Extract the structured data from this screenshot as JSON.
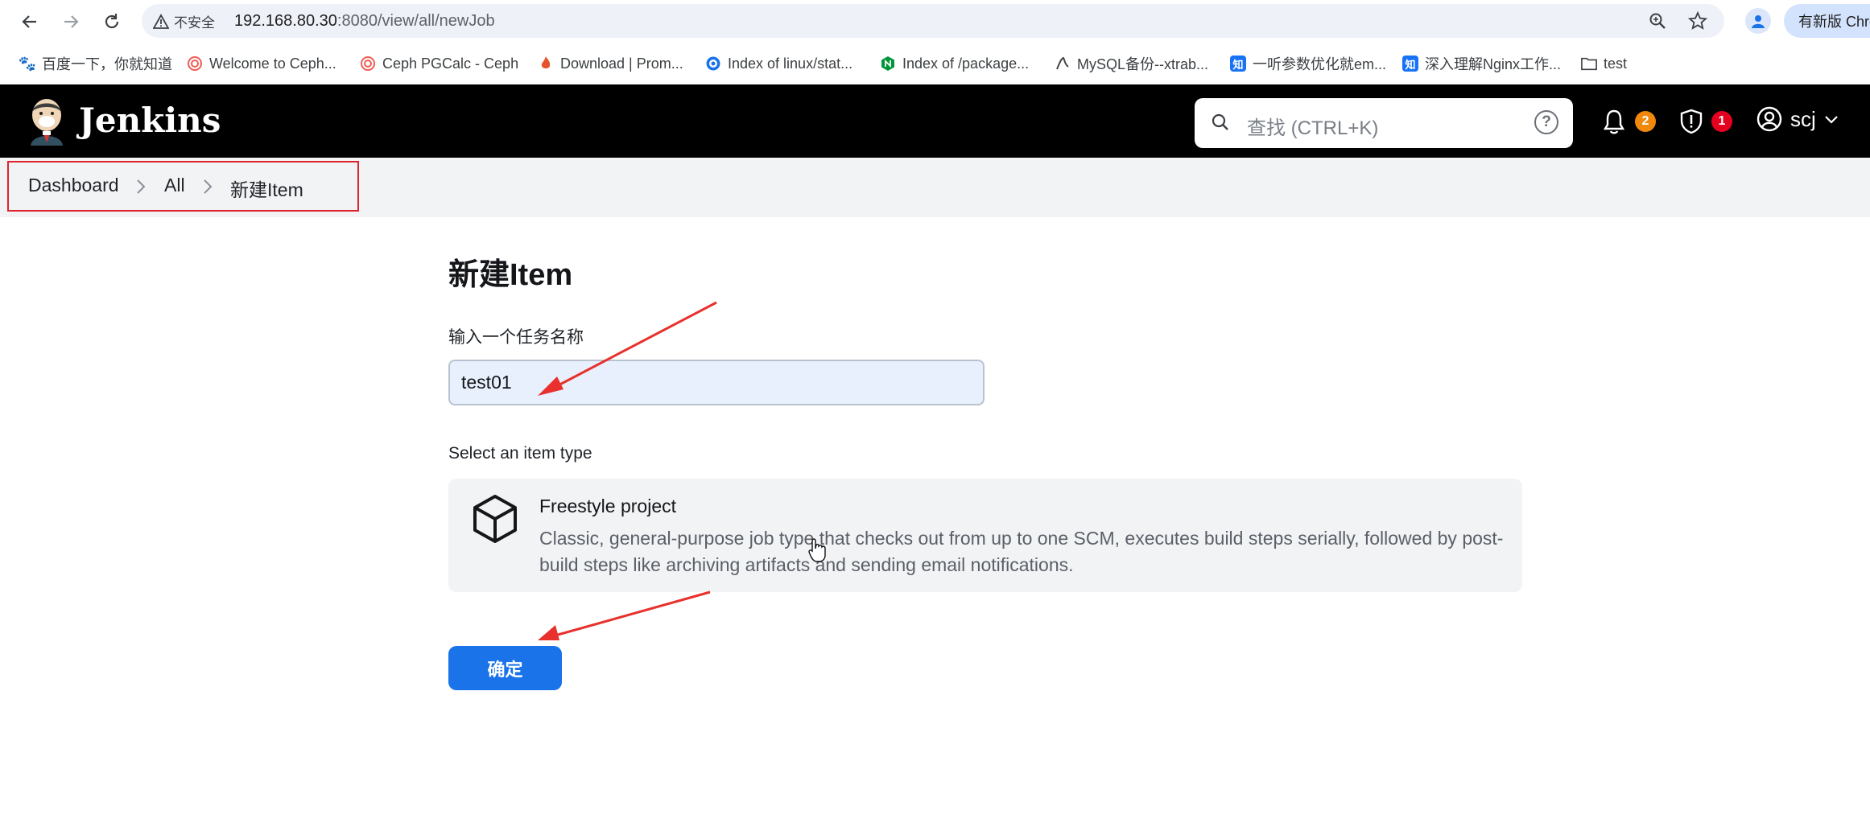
{
  "browser": {
    "security_label": "不安全",
    "url_host": "192.168.80.30",
    "url_rest": ":8080/view/all/newJob",
    "update_label": "有新版 Chro"
  },
  "bookmarks": [
    {
      "label": "百度一下，你就知道",
      "icon": "baidu-icon",
      "color": "#2932e1"
    },
    {
      "label": "Welcome to Ceph...",
      "icon": "ceph-icon",
      "color": "#ef5c55"
    },
    {
      "label": "Ceph PGCalc - Ceph",
      "icon": "ceph-icon",
      "color": "#ef5c55"
    },
    {
      "label": "Download | Prom...",
      "icon": "prometheus-icon",
      "color": "#e6522c"
    },
    {
      "label": "Index of linux/stat...",
      "icon": "globe-icon",
      "color": "#1a73e8"
    },
    {
      "label": "Index of /package...",
      "icon": "nginx-icon",
      "color": "#009639"
    },
    {
      "label": "MySQL备份--xtrab...",
      "icon": "mysql-icon",
      "color": "#444444"
    },
    {
      "label": "一听参数优化就em...",
      "icon": "zhihu-icon",
      "color": "#1772f6"
    },
    {
      "label": "深入理解Nginx工作...",
      "icon": "zhihu-icon",
      "color": "#1772f6"
    },
    {
      "label": "test",
      "icon": "folder-icon",
      "color": "#3c4043"
    }
  ],
  "jenkins": {
    "title": "Jenkins",
    "search_placeholder": "查找 (CTRL+K)",
    "help_glyph": "?",
    "notifications_count": "2",
    "security_count": "1",
    "username": "scj",
    "colors": {
      "header": "#000000",
      "notify_badge": "#f0880c",
      "security_badge": "#e6001f",
      "primary": "#1a73e8"
    }
  },
  "breadcrumb": [
    "Dashboard",
    "All",
    "新建Item"
  ],
  "main": {
    "page_title": "新建Item",
    "name_label": "输入一个任务名称",
    "name_value": "test01",
    "type_label": "Select an item type",
    "item_types": [
      {
        "name": "Freestyle project",
        "icon": "package-box-icon",
        "description": "Classic, general-purpose job type that checks out from up to one SCM, executes build steps serially, followed by post-build steps like archiving artifacts and sending email notifications."
      }
    ],
    "ok_label": "确定"
  }
}
